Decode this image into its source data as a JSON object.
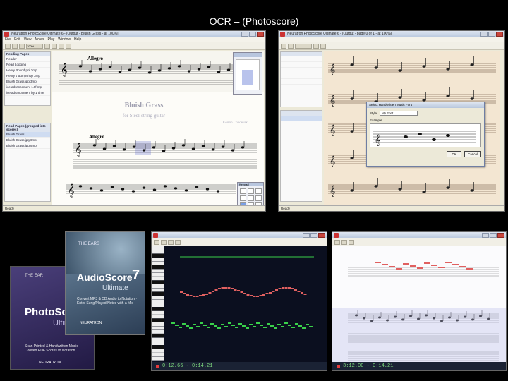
{
  "slide_title": "OCR – (Photoscore)",
  "main_window": {
    "title": "Neuratron PhotoScore Ultimate 6 - [Output - Bluish Grass - at 100%]",
    "menu": [
      "File",
      "Edit",
      "View",
      "Notes",
      "Play",
      "Window",
      "Help"
    ],
    "toolbar_zoom": "100%",
    "panel_top_header": "Pending Pages",
    "panel_top_items": [
      "Reader",
      "Read Logging",
      "Henry Bound ppl 3mp",
      "Henry's Bumpshop 3mp",
      "Bluish Grass.jpg 3mp",
      "ice advancement 1.tif mp",
      "ice advancement by 1 time"
    ],
    "panel_bottom_header": "Read Pages (grouped into scores)",
    "panel_bottom_items": [
      "Bluish Grass",
      "Bluish Grass.jpg 6mp",
      "Bluish Grass.jpg 9mp"
    ],
    "tempo_top": "Allegro",
    "tempo_bottom": "Allegro",
    "score_title": "Bluish Grass",
    "score_subtitle": "for Steel-string guitar",
    "composer": "Keiron Chudevski",
    "keypad_title": "Keypad",
    "status": "Ready"
  },
  "right_window": {
    "title": "Neuratron PhotoScore Ultimate 6 - [Output - page 0 of 1 - at 100%]",
    "dialog_title": "Select Handwritten Music Font",
    "dialog_style_label": "Style",
    "dialog_style_value": "My Font",
    "dialog_example_label": "Example",
    "dialog_ok": "OK",
    "dialog_cancel": "Cancel",
    "status": "Ready"
  },
  "boxes": {
    "back_brand": "THE EAR",
    "back_product": "PhotoScore",
    "back_edition": "Ultimate",
    "back_tagline": "Scan Printed & Handwritten Music · Convert PDF Scores to Notation",
    "back_maker": "NEURATRON",
    "front_brand": "THE EARS",
    "front_product": "AudioScore",
    "front_edition": "Ultimate",
    "front_version": "7",
    "front_tagline": "Convert MP3 & CD Audio to Notation · Enter Sung/Played Notes with a Mic",
    "front_maker": "NEURATRON"
  },
  "audio_window_1": {
    "timecode": "0:12.66 - 0:14.21"
  },
  "audio_window_2": {
    "timecode": "3:12.00 - 0:14.21"
  },
  "colors": {
    "slide_bg": "#000000",
    "score_paper": "#fdfcf8",
    "aged_paper": "#f3e6d2",
    "piano_roll_bg": "#0b0f1f",
    "note_red": "#e06060",
    "note_green": "#39d04a",
    "accent_blue": "#3b5998"
  }
}
